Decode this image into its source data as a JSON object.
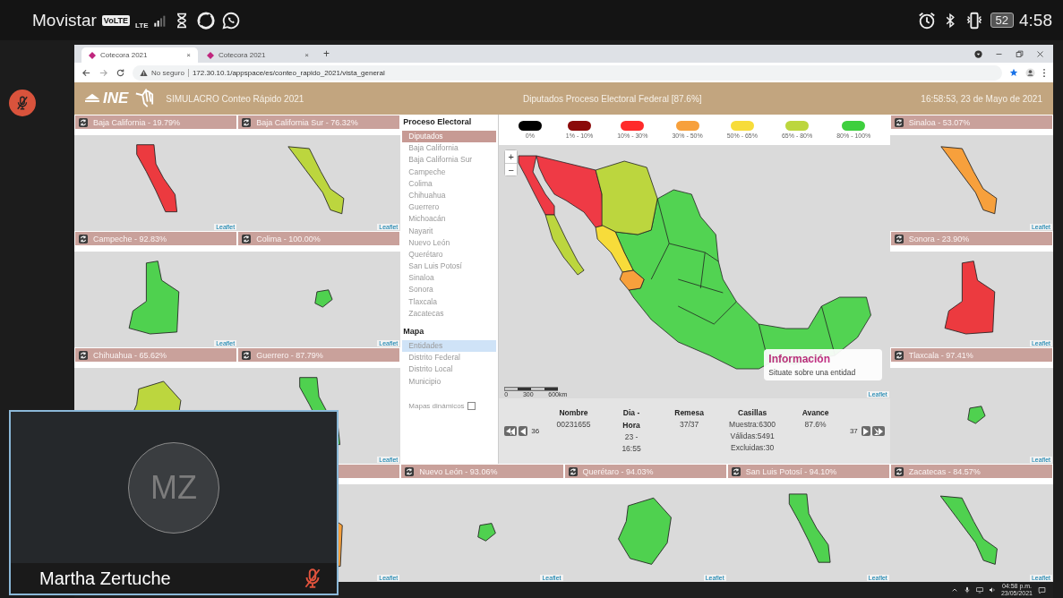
{
  "status_bar": {
    "carrier": "Movistar",
    "volte": "VoLTE",
    "network": "LTE",
    "battery": "52",
    "time": "4:58"
  },
  "browser": {
    "tabs": [
      {
        "title": "Cotecora 2021",
        "close": "×",
        "selected": true
      },
      {
        "title": "Cotecora 2021",
        "close": "×",
        "selected": false
      }
    ],
    "new_tab": "+",
    "security": "No seguro",
    "url": "172.30.10.1/appspace/es/conteo_rapido_2021/vista_general"
  },
  "header": {
    "logo": "INE",
    "title": "SIMULACRO Conteo Rápido 2021",
    "subtitle": "Diputados Proceso Electoral Federal  [87.6%]",
    "datetime": "16:58:53, 23 de Mayo de 2021"
  },
  "left_panels": [
    {
      "title": "Baja California - 19.79%",
      "color": "#ec3a3f",
      "attribution": "Leaflet"
    },
    {
      "title": "Baja California Sur - 76.32%",
      "color": "#bcd63e",
      "attribution": "Leaflet"
    },
    {
      "title": "Campeche - 92.83%",
      "color": "#4fd14f",
      "attribution": "Leaflet"
    },
    {
      "title": "Colima - 100.00%",
      "color": "#4fd14f",
      "attribution": "Leaflet"
    },
    {
      "title": "Chihuahua - 65.62%",
      "color": "#bcd63e"
    },
    {
      "title": "Guerrero - 87.79%",
      "color": "#4fd14f",
      "attribution": "Leaflet"
    }
  ],
  "right_panels": [
    {
      "title": "Sinaloa - 53.07%",
      "color": "#f7a03c",
      "attribution": "Leaflet"
    },
    {
      "title": "Sonora - 23.90%",
      "color": "#ec3a3f",
      "attribution": "Leaflet"
    },
    {
      "title": "Tlaxcala - 97.41%",
      "color": "#4fd14f",
      "attribution": "Leaflet"
    }
  ],
  "bottom_panels": [
    {
      "color": "#f7a03c",
      "attribution": "Leaflet"
    },
    {
      "title": "Nuevo León - 93.06%",
      "color": "#4fd14f",
      "attribution": "Leaflet"
    },
    {
      "title": "Querétaro - 94.03%",
      "color": "#4fd14f",
      "attribution": "Leaflet"
    },
    {
      "title": "San Luis Potosí - 94.10%",
      "color": "#4fd14f",
      "attribution": "Leaflet"
    },
    {
      "title": "Zacatecas - 84.57%",
      "color": "#4fd14f",
      "attribution": "Leaflet"
    }
  ],
  "sidebar": {
    "groups": [
      {
        "heading": "Proceso Electoral",
        "items": [
          {
            "label": "Diputados",
            "selected": true
          },
          {
            "label": "Baja California",
            "selected": false
          },
          {
            "label": "Baja California Sur",
            "selected": false
          },
          {
            "label": "Campeche",
            "selected": false
          },
          {
            "label": "Colima",
            "selected": false
          },
          {
            "label": "Chihuahua",
            "selected": false
          },
          {
            "label": "Guerrero",
            "selected": false
          },
          {
            "label": "Michoacán",
            "selected": false
          },
          {
            "label": "Nayarit",
            "selected": false
          },
          {
            "label": "Nuevo León",
            "selected": false
          },
          {
            "label": "Querétaro",
            "selected": false
          },
          {
            "label": "San Luis Potosí",
            "selected": false
          },
          {
            "label": "Sinaloa",
            "selected": false
          },
          {
            "label": "Sonora",
            "selected": false
          },
          {
            "label": "Tlaxcala",
            "selected": false
          },
          {
            "label": "Zacatecas",
            "selected": false
          }
        ]
      },
      {
        "heading": "Mapa",
        "items": [
          {
            "label": "Entidades",
            "selected": true
          },
          {
            "label": "Distrito Federal",
            "selected": false
          },
          {
            "label": "Distrito Local",
            "selected": false
          },
          {
            "label": "Municipio",
            "selected": false
          }
        ]
      }
    ],
    "dynamic_maps": {
      "label": "Mapas dinámicos",
      "checked": false
    }
  },
  "legend": [
    {
      "label": "0%",
      "color": "#000000"
    },
    {
      "label": "1% - 10%",
      "color": "#8b0a0a"
    },
    {
      "label": "10% - 30%",
      "color": "#ff2a2a"
    },
    {
      "label": "30% - 50%",
      "color": "#f7a03c"
    },
    {
      "label": "50% - 65%",
      "color": "#f7dc3a"
    },
    {
      "label": "65% - 80%",
      "color": "#bcd63e"
    },
    {
      "label": "80% - 100%",
      "color": "#3ecf3e"
    }
  ],
  "map": {
    "zoom_in": "+",
    "zoom_out": "−",
    "scale": [
      "0",
      "300",
      "600km"
    ],
    "attribution": "Leaflet",
    "info_title": "Información",
    "info_text": "Situate sobre una entidad"
  },
  "summary": {
    "prev": "36",
    "next": "37",
    "columns": [
      {
        "heading": "Nombre",
        "values": [
          "00231655"
        ]
      },
      {
        "heading": "Dia - Hora",
        "values": [
          "23 -",
          "16:55"
        ]
      },
      {
        "heading": "Remesa",
        "values": [
          "37/37"
        ]
      },
      {
        "heading": "Casillas",
        "values": [
          "Muestra:6300",
          "Válidas:5491",
          "Excluidas:30"
        ]
      },
      {
        "heading": "Avance",
        "values": [
          "87.6%"
        ]
      }
    ]
  },
  "taskbar": {
    "time": "04:58 p.m.",
    "date": "23/05/2021"
  },
  "video_tile": {
    "initials": "MZ",
    "name": "Martha Zertuche"
  }
}
